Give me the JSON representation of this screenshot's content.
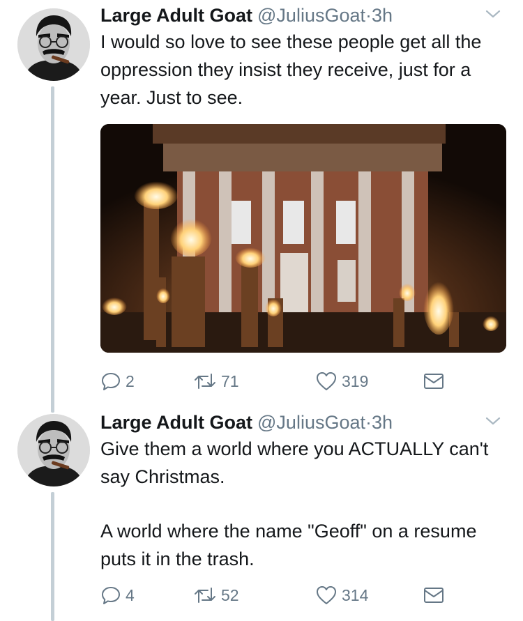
{
  "tweets": [
    {
      "display_name": "Large Adult Goat",
      "handle": "@JuliusGoat",
      "separator": "·",
      "time": "3h",
      "text": [
        "I would so love to see these people get all the oppression they insist they receive, just for a year. Just to see."
      ],
      "has_media": true,
      "replies": "2",
      "retweets": "71",
      "likes": "319"
    },
    {
      "display_name": "Large Adult Goat",
      "handle": "@JuliusGoat",
      "separator": "·",
      "time": "3h",
      "text": [
        "Give them a world where you ACTUALLY can't say Christmas.",
        "A world where the name \"Geoff\" on a resume puts it in the trash."
      ],
      "has_media": false,
      "replies": "4",
      "retweets": "52",
      "likes": "314"
    }
  ],
  "icons": {
    "reply": "reply-icon",
    "retweet": "retweet-icon",
    "like": "heart-icon",
    "dm": "envelope-icon",
    "menu": "chevron-down-icon"
  },
  "colors": {
    "text": "#14171a",
    "secondary": "#657786",
    "thread_line": "#c4cfd6"
  }
}
